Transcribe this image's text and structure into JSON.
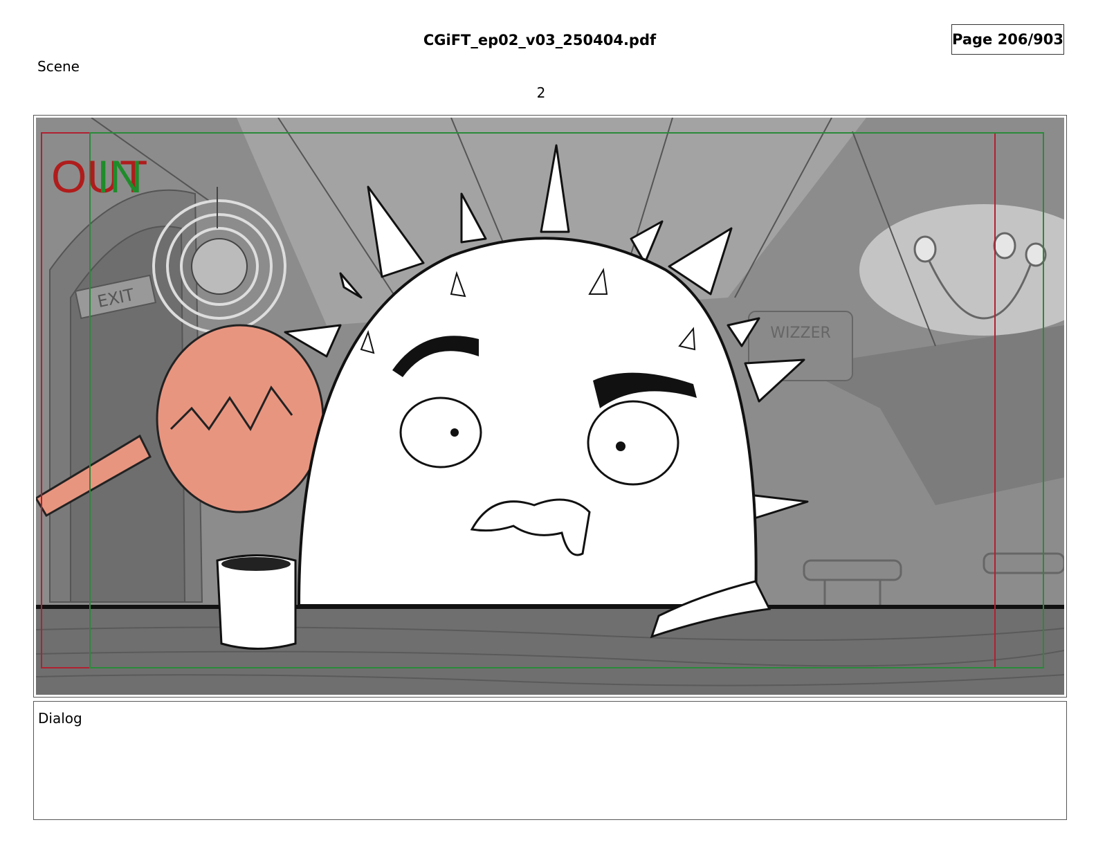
{
  "header": {
    "file_name": "CGiFT_ep02_v03_250404.pdf",
    "page_label": "Page 206/903"
  },
  "scene": {
    "label": "Scene",
    "number": "2"
  },
  "panel": {
    "overlay_text_out": "OUT",
    "overlay_text_in": "IN",
    "sign_exit": "EXIT",
    "sign_wizzer": "WIZZER",
    "colors": {
      "out_red": "#b01c1c",
      "in_green": "#1e8c2a",
      "frame_red": "#b02030",
      "frame_green": "#2a8a3a",
      "drumstick": "#e89580",
      "background_gray": "#8a8a8a"
    }
  },
  "dialog": {
    "label": "Dialog",
    "text": ""
  }
}
